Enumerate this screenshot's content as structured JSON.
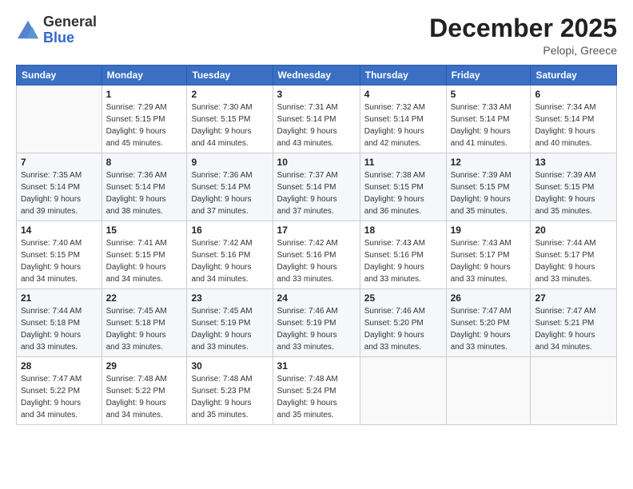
{
  "logo": {
    "general": "General",
    "blue": "Blue"
  },
  "title": {
    "month": "December 2025",
    "location": "Pelopi, Greece"
  },
  "weekdays": [
    "Sunday",
    "Monday",
    "Tuesday",
    "Wednesday",
    "Thursday",
    "Friday",
    "Saturday"
  ],
  "weeks": [
    [
      {
        "day": "",
        "sunrise": "",
        "sunset": "",
        "daylight": ""
      },
      {
        "day": "1",
        "sunrise": "Sunrise: 7:29 AM",
        "sunset": "Sunset: 5:15 PM",
        "daylight": "Daylight: 9 hours and 45 minutes."
      },
      {
        "day": "2",
        "sunrise": "Sunrise: 7:30 AM",
        "sunset": "Sunset: 5:15 PM",
        "daylight": "Daylight: 9 hours and 44 minutes."
      },
      {
        "day": "3",
        "sunrise": "Sunrise: 7:31 AM",
        "sunset": "Sunset: 5:14 PM",
        "daylight": "Daylight: 9 hours and 43 minutes."
      },
      {
        "day": "4",
        "sunrise": "Sunrise: 7:32 AM",
        "sunset": "Sunset: 5:14 PM",
        "daylight": "Daylight: 9 hours and 42 minutes."
      },
      {
        "day": "5",
        "sunrise": "Sunrise: 7:33 AM",
        "sunset": "Sunset: 5:14 PM",
        "daylight": "Daylight: 9 hours and 41 minutes."
      },
      {
        "day": "6",
        "sunrise": "Sunrise: 7:34 AM",
        "sunset": "Sunset: 5:14 PM",
        "daylight": "Daylight: 9 hours and 40 minutes."
      }
    ],
    [
      {
        "day": "7",
        "sunrise": "Sunrise: 7:35 AM",
        "sunset": "Sunset: 5:14 PM",
        "daylight": "Daylight: 9 hours and 39 minutes."
      },
      {
        "day": "8",
        "sunrise": "Sunrise: 7:36 AM",
        "sunset": "Sunset: 5:14 PM",
        "daylight": "Daylight: 9 hours and 38 minutes."
      },
      {
        "day": "9",
        "sunrise": "Sunrise: 7:36 AM",
        "sunset": "Sunset: 5:14 PM",
        "daylight": "Daylight: 9 hours and 37 minutes."
      },
      {
        "day": "10",
        "sunrise": "Sunrise: 7:37 AM",
        "sunset": "Sunset: 5:14 PM",
        "daylight": "Daylight: 9 hours and 37 minutes."
      },
      {
        "day": "11",
        "sunrise": "Sunrise: 7:38 AM",
        "sunset": "Sunset: 5:15 PM",
        "daylight": "Daylight: 9 hours and 36 minutes."
      },
      {
        "day": "12",
        "sunrise": "Sunrise: 7:39 AM",
        "sunset": "Sunset: 5:15 PM",
        "daylight": "Daylight: 9 hours and 35 minutes."
      },
      {
        "day": "13",
        "sunrise": "Sunrise: 7:39 AM",
        "sunset": "Sunset: 5:15 PM",
        "daylight": "Daylight: 9 hours and 35 minutes."
      }
    ],
    [
      {
        "day": "14",
        "sunrise": "Sunrise: 7:40 AM",
        "sunset": "Sunset: 5:15 PM",
        "daylight": "Daylight: 9 hours and 34 minutes."
      },
      {
        "day": "15",
        "sunrise": "Sunrise: 7:41 AM",
        "sunset": "Sunset: 5:15 PM",
        "daylight": "Daylight: 9 hours and 34 minutes."
      },
      {
        "day": "16",
        "sunrise": "Sunrise: 7:42 AM",
        "sunset": "Sunset: 5:16 PM",
        "daylight": "Daylight: 9 hours and 34 minutes."
      },
      {
        "day": "17",
        "sunrise": "Sunrise: 7:42 AM",
        "sunset": "Sunset: 5:16 PM",
        "daylight": "Daylight: 9 hours and 33 minutes."
      },
      {
        "day": "18",
        "sunrise": "Sunrise: 7:43 AM",
        "sunset": "Sunset: 5:16 PM",
        "daylight": "Daylight: 9 hours and 33 minutes."
      },
      {
        "day": "19",
        "sunrise": "Sunrise: 7:43 AM",
        "sunset": "Sunset: 5:17 PM",
        "daylight": "Daylight: 9 hours and 33 minutes."
      },
      {
        "day": "20",
        "sunrise": "Sunrise: 7:44 AM",
        "sunset": "Sunset: 5:17 PM",
        "daylight": "Daylight: 9 hours and 33 minutes."
      }
    ],
    [
      {
        "day": "21",
        "sunrise": "Sunrise: 7:44 AM",
        "sunset": "Sunset: 5:18 PM",
        "daylight": "Daylight: 9 hours and 33 minutes."
      },
      {
        "day": "22",
        "sunrise": "Sunrise: 7:45 AM",
        "sunset": "Sunset: 5:18 PM",
        "daylight": "Daylight: 9 hours and 33 minutes."
      },
      {
        "day": "23",
        "sunrise": "Sunrise: 7:45 AM",
        "sunset": "Sunset: 5:19 PM",
        "daylight": "Daylight: 9 hours and 33 minutes."
      },
      {
        "day": "24",
        "sunrise": "Sunrise: 7:46 AM",
        "sunset": "Sunset: 5:19 PM",
        "daylight": "Daylight: 9 hours and 33 minutes."
      },
      {
        "day": "25",
        "sunrise": "Sunrise: 7:46 AM",
        "sunset": "Sunset: 5:20 PM",
        "daylight": "Daylight: 9 hours and 33 minutes."
      },
      {
        "day": "26",
        "sunrise": "Sunrise: 7:47 AM",
        "sunset": "Sunset: 5:20 PM",
        "daylight": "Daylight: 9 hours and 33 minutes."
      },
      {
        "day": "27",
        "sunrise": "Sunrise: 7:47 AM",
        "sunset": "Sunset: 5:21 PM",
        "daylight": "Daylight: 9 hours and 34 minutes."
      }
    ],
    [
      {
        "day": "28",
        "sunrise": "Sunrise: 7:47 AM",
        "sunset": "Sunset: 5:22 PM",
        "daylight": "Daylight: 9 hours and 34 minutes."
      },
      {
        "day": "29",
        "sunrise": "Sunrise: 7:48 AM",
        "sunset": "Sunset: 5:22 PM",
        "daylight": "Daylight: 9 hours and 34 minutes."
      },
      {
        "day": "30",
        "sunrise": "Sunrise: 7:48 AM",
        "sunset": "Sunset: 5:23 PM",
        "daylight": "Daylight: 9 hours and 35 minutes."
      },
      {
        "day": "31",
        "sunrise": "Sunrise: 7:48 AM",
        "sunset": "Sunset: 5:24 PM",
        "daylight": "Daylight: 9 hours and 35 minutes."
      },
      {
        "day": "",
        "sunrise": "",
        "sunset": "",
        "daylight": ""
      },
      {
        "day": "",
        "sunrise": "",
        "sunset": "",
        "daylight": ""
      },
      {
        "day": "",
        "sunrise": "",
        "sunset": "",
        "daylight": ""
      }
    ]
  ]
}
